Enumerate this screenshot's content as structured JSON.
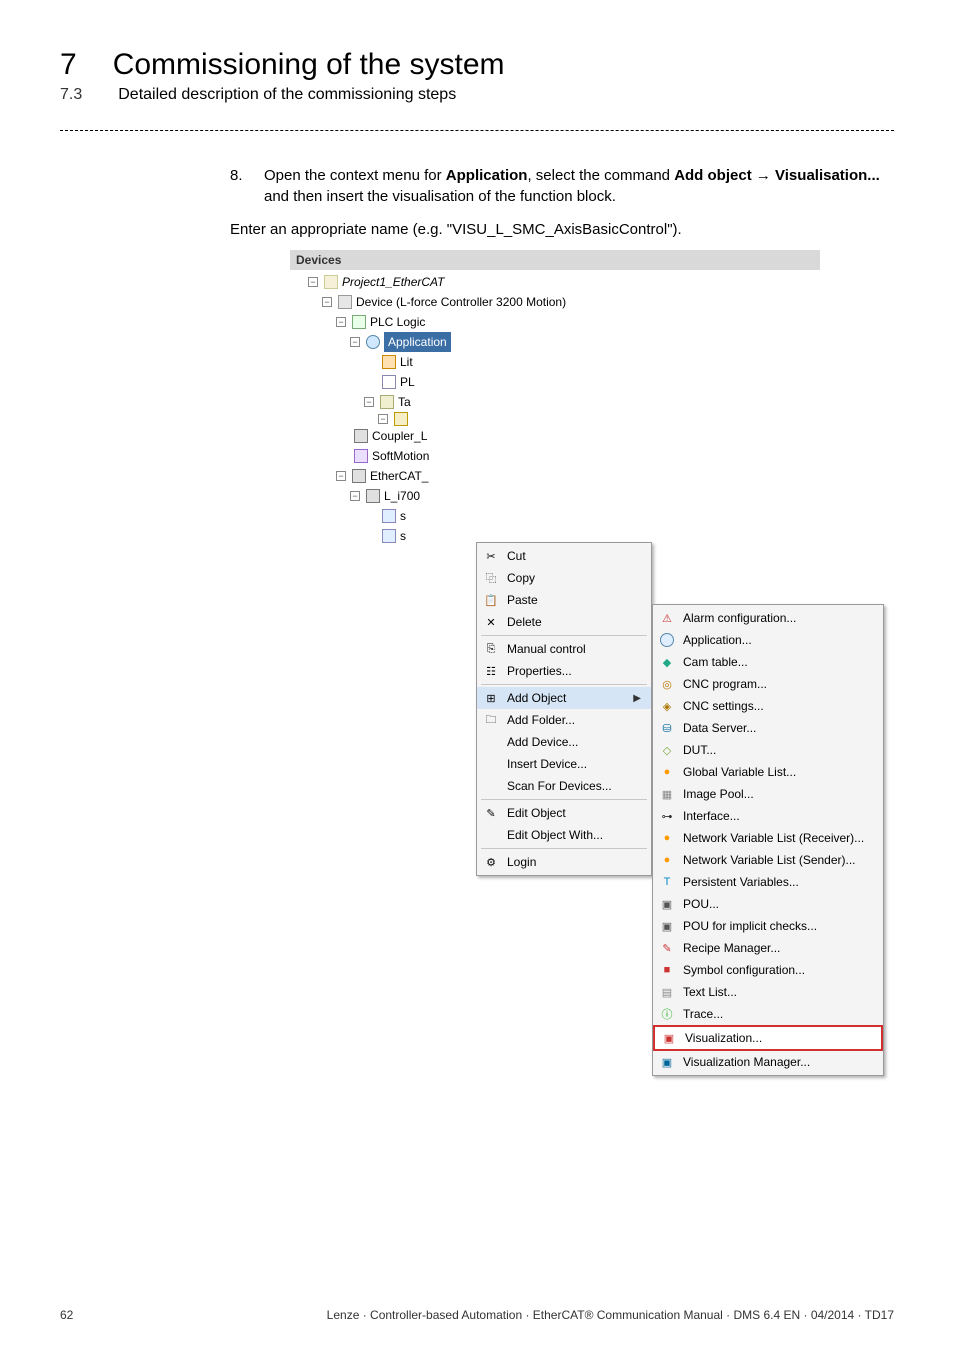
{
  "header": {
    "chapter_number": "7",
    "chapter_title": "Commissioning of the system",
    "section_number": "7.3",
    "section_title": "Detailed description of the commissioning steps"
  },
  "step": {
    "number": "8.",
    "part1": "Open the context menu for ",
    "bold1": "Application",
    "part2": ", select the command ",
    "bold2": "Add object",
    "arrow": " → ",
    "bold3": "Visualisation...",
    "part3": " and then insert the visualisation of the function block."
  },
  "enter_line": "Enter an appropriate name (e.g. \"VISU_L_SMC_AxisBasicControl\").",
  "screenshot": {
    "title": "Devices",
    "tree": {
      "project": "Project1_EtherCAT",
      "device": "Device (L-force Controller 3200 Motion)",
      "plc": "PLC Logic",
      "application": "Application",
      "lib": "Lit",
      "pl": "PL",
      "ta": "Ta",
      "coupler": "Coupler_L",
      "softmotion": "SoftMotion",
      "ethercat": "EtherCAT_",
      "li700": "L_i700",
      "s1": "s",
      "s2": "s"
    },
    "ctx1_items": {
      "cut": "Cut",
      "copy": "Copy",
      "paste": "Paste",
      "delete": "Delete",
      "manual": "Manual control",
      "properties": "Properties...",
      "add_object": "Add Object",
      "add_folder": "Add Folder...",
      "add_device": "Add Device...",
      "insert_device": "Insert Device...",
      "scan": "Scan For Devices...",
      "edit_object": "Edit Object",
      "edit_with": "Edit Object With...",
      "login": "Login"
    },
    "ctx1_icons": {
      "cut": "✂",
      "copy": "⿻",
      "paste": "📋",
      "delete": "✕",
      "manual": "⎘",
      "properties": "☷",
      "add_object": "⊞",
      "add_folder": "🗀",
      "edit_object": "✎",
      "login": "⚙"
    },
    "ctx2_items": {
      "alarm": "Alarm configuration...",
      "application": "Application...",
      "cam": "Cam table...",
      "cnc_prog": "CNC program...",
      "cnc_set": "CNC settings...",
      "data_server": "Data Server...",
      "dut": "DUT...",
      "gvl": "Global Variable List...",
      "image_pool": "Image Pool...",
      "interface": "Interface...",
      "nvlr": "Network Variable List (Receiver)...",
      "nvls": "Network Variable List (Sender)...",
      "pv": "Persistent Variables...",
      "pou": "POU...",
      "pou_imp": "POU for implicit checks...",
      "recipe": "Recipe Manager...",
      "symbol": "Symbol configuration...",
      "text_list": "Text List...",
      "trace": "Trace...",
      "visualization": "Visualization...",
      "viz_manager": "Visualization Manager..."
    }
  },
  "footer": {
    "page": "62",
    "right": "Lenze · Controller-based Automation · EtherCAT® Communication Manual · DMS 6.4 EN · 04/2014 · TD17"
  }
}
